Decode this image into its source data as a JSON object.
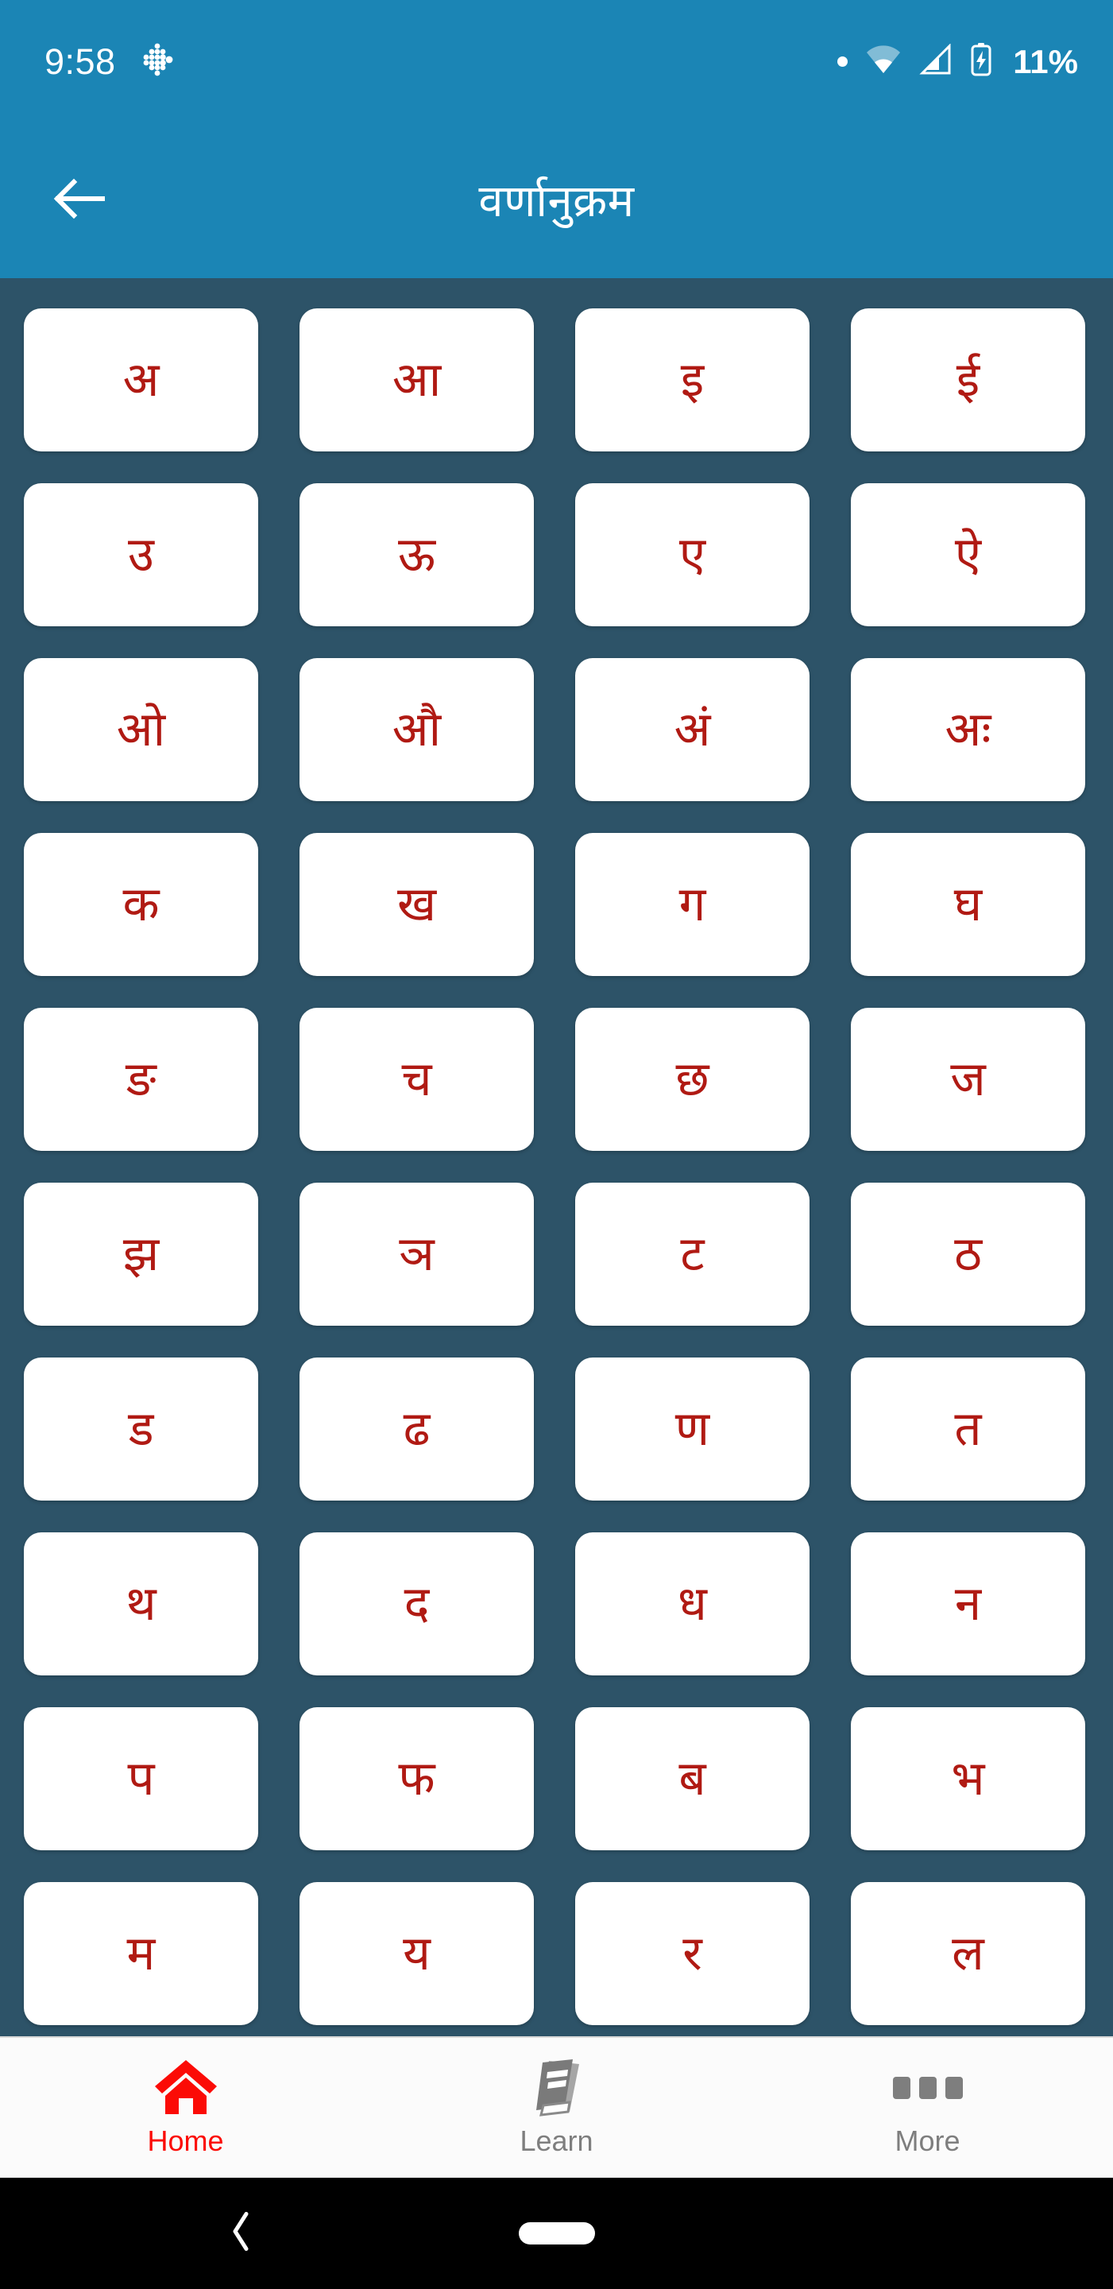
{
  "status_bar": {
    "time": "9:58",
    "app_icon": "fitbit-icon",
    "icons": [
      "dot-indicator-icon",
      "wifi-icon",
      "cellular-signal-icon",
      "battery-charging-icon"
    ],
    "battery_percent": "11%"
  },
  "app_bar": {
    "back_icon": "back-arrow-icon",
    "title": "वर्णानुक्रम",
    "background_color": "#1b85b5",
    "title_color": "#ffffff"
  },
  "content": {
    "background_color": "#2d5368",
    "card_background": "#ffffff",
    "letter_color": "#b01a13",
    "columns": 4,
    "letters": [
      "अ",
      "आ",
      "इ",
      "ई",
      "उ",
      "ऊ",
      "ए",
      "ऐ",
      "ओ",
      "औ",
      "अं",
      "अः",
      "क",
      "ख",
      "ग",
      "घ",
      "ङ",
      "च",
      "छ",
      "ज",
      "झ",
      "ञ",
      "ट",
      "ठ",
      "ड",
      "ढ",
      "ण",
      "त",
      "थ",
      "द",
      "ध",
      "न",
      "प",
      "फ",
      "ब",
      "भ",
      "म",
      "य",
      "र",
      "ल"
    ]
  },
  "bottom_nav": {
    "active_color": "#fb0b06",
    "inactive_color": "#7e7e7e",
    "items": [
      {
        "label": "Home",
        "icon": "home-icon",
        "active": true
      },
      {
        "label": "Learn",
        "icon": "book-icon",
        "active": false
      },
      {
        "label": "More",
        "icon": "more-dots-icon",
        "active": false
      }
    ]
  },
  "gesture_bar": {
    "back_icon": "gesture-back-icon",
    "home_pill": "gesture-home-pill"
  }
}
